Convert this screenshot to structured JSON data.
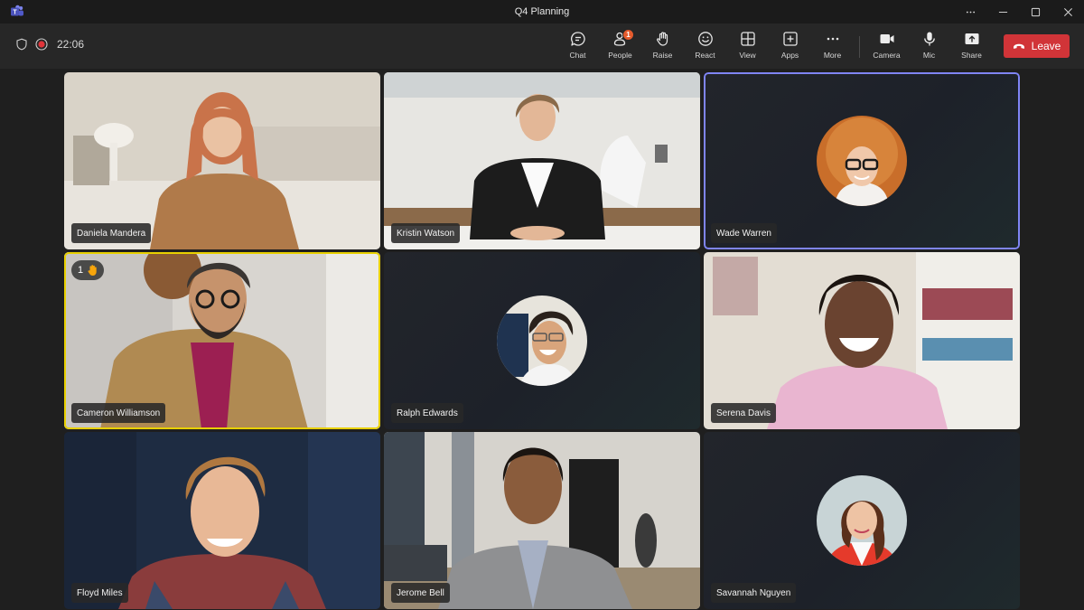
{
  "window": {
    "title": "Q4 Planning",
    "app_icon": "teams-logo-icon",
    "controls": [
      "more-options",
      "minimize",
      "maximize",
      "close"
    ]
  },
  "toolbar": {
    "status": {
      "security_icon": "shield-icon",
      "recording_icon": "recording-icon",
      "timer": "22:06"
    },
    "buttons": [
      {
        "id": "chat",
        "label": "Chat",
        "icon": "chat-icon"
      },
      {
        "id": "people",
        "label": "People",
        "icon": "people-icon",
        "badge": "1"
      },
      {
        "id": "raise",
        "label": "Raise",
        "icon": "raise-hand-icon"
      },
      {
        "id": "react",
        "label": "React",
        "icon": "smiley-icon"
      },
      {
        "id": "view",
        "label": "View",
        "icon": "grid-view-icon"
      },
      {
        "id": "apps",
        "label": "Apps",
        "icon": "apps-plus-icon"
      },
      {
        "id": "more",
        "label": "More",
        "icon": "ellipsis-icon"
      }
    ],
    "media_buttons": [
      {
        "id": "camera",
        "label": "Camera",
        "icon": "camera-icon"
      },
      {
        "id": "mic",
        "label": "Mic",
        "icon": "microphone-icon"
      },
      {
        "id": "share",
        "label": "Share",
        "icon": "share-screen-icon"
      }
    ],
    "leave": {
      "label": "Leave",
      "icon": "hang-up-icon",
      "color": "#d13438"
    }
  },
  "colors": {
    "active_speaker_outline": "#7f85f5",
    "raised_hand_outline": "#e8d000",
    "badge": "#e55b2d",
    "recording": "#e0343a"
  },
  "participants": [
    {
      "name": "Daniela Mandera",
      "video": "on",
      "state": ""
    },
    {
      "name": "Kristin Watson",
      "video": "on",
      "state": ""
    },
    {
      "name": "Wade Warren",
      "video": "off",
      "state": "active-speaker"
    },
    {
      "name": "Cameron Williamson",
      "video": "on",
      "state": "hand-raised",
      "hand_raise_order": "1"
    },
    {
      "name": "Ralph Edwards",
      "video": "off",
      "state": ""
    },
    {
      "name": "Serena Davis",
      "video": "on",
      "state": ""
    },
    {
      "name": "Floyd Miles",
      "video": "on",
      "state": ""
    },
    {
      "name": "Jerome Bell",
      "video": "on",
      "state": ""
    },
    {
      "name": "Savannah Nguyen",
      "video": "off",
      "state": ""
    }
  ]
}
